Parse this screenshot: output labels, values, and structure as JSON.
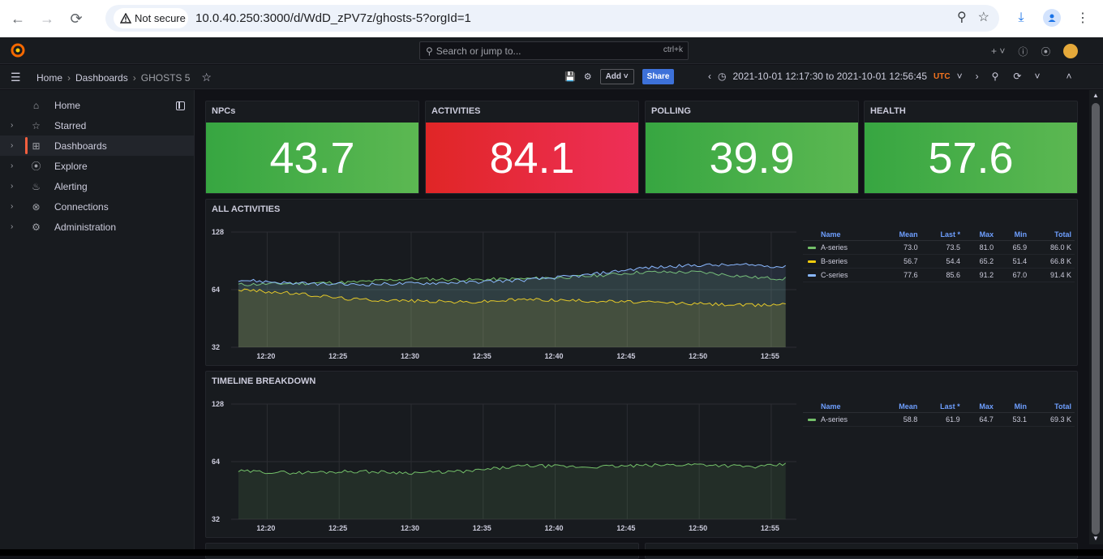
{
  "browser": {
    "security_label": "Not secure",
    "url": "10.0.40.250:3000/d/WdD_zPV7z/ghosts-5?orgId=1"
  },
  "topbar": {
    "search_placeholder": "Search or jump to...",
    "search_shortcut": "ctrl+k",
    "plus_label": "+"
  },
  "breadcrumb": {
    "home": "Home",
    "dashboards": "Dashboards",
    "current": "GHOSTS 5"
  },
  "toolbar": {
    "add_label": "Add",
    "share_label": "Share",
    "time_range": "2021-10-01 12:17:30 to 2021-10-01 12:56:45",
    "timezone": "UTC"
  },
  "sidebar": {
    "items": [
      {
        "label": "Home",
        "icon": "home-icon"
      },
      {
        "label": "Starred",
        "icon": "star-icon"
      },
      {
        "label": "Dashboards",
        "icon": "apps-icon"
      },
      {
        "label": "Explore",
        "icon": "compass-icon"
      },
      {
        "label": "Alerting",
        "icon": "bell-icon"
      },
      {
        "label": "Connections",
        "icon": "plug-icon"
      },
      {
        "label": "Administration",
        "icon": "cog-icon"
      }
    ]
  },
  "stats": [
    {
      "title": "NPCs",
      "value": "43.7",
      "color": "green"
    },
    {
      "title": "ACTIVITIES",
      "value": "84.1",
      "color": "red"
    },
    {
      "title": "POLLING",
      "value": "39.9",
      "color": "green"
    },
    {
      "title": "HEALTH",
      "value": "57.6",
      "color": "green"
    }
  ],
  "colors": {
    "a_series": "#73bf69",
    "b_series": "#f2cc0c",
    "c_series": "#8ab8ff",
    "stat_green": "#56a64b",
    "stat_red": "#e02f44"
  },
  "panels": {
    "all_activities": {
      "title": "ALL ACTIVITIES",
      "legend_headers": [
        "Name",
        "Mean",
        "Last *",
        "Max",
        "Min",
        "Total"
      ],
      "rows": [
        {
          "name": "A-series",
          "mean": "73.0",
          "last": "73.5",
          "max": "81.0",
          "min": "65.9",
          "total": "86.0 K"
        },
        {
          "name": "B-series",
          "mean": "56.7",
          "last": "54.4",
          "max": "65.2",
          "min": "51.4",
          "total": "66.8 K"
        },
        {
          "name": "C-series",
          "mean": "77.6",
          "last": "85.6",
          "max": "91.2",
          "min": "67.0",
          "total": "91.4 K"
        }
      ]
    },
    "timeline_breakdown": {
      "title": "TIMELINE BREAKDOWN",
      "legend_headers": [
        "Name",
        "Mean",
        "Last *",
        "Max",
        "Min",
        "Total"
      ],
      "rows": [
        {
          "name": "A-series",
          "mean": "58.8",
          "last": "61.9",
          "max": "64.7",
          "min": "53.1",
          "total": "69.3 K"
        }
      ]
    }
  },
  "chart_data": [
    {
      "type": "area",
      "title": "ALL ACTIVITIES",
      "x_ticks": [
        "12:20",
        "12:25",
        "12:30",
        "12:35",
        "12:40",
        "12:45",
        "12:50",
        "12:55"
      ],
      "y_ticks": [
        "32",
        "64",
        "128"
      ],
      "ylim": [
        32,
        128
      ],
      "yscale": "log2",
      "x_range": [
        "12:17:30",
        "12:56:45"
      ],
      "series": [
        {
          "name": "A-series",
          "color": "#73bf69",
          "x": [
            "12:18",
            "12:22",
            "12:26",
            "12:30",
            "12:34",
            "12:38",
            "12:42",
            "12:46",
            "12:50",
            "12:54",
            "12:56"
          ],
          "values": [
            68,
            69,
            70,
            73,
            72,
            73,
            75,
            79,
            79,
            74,
            73
          ]
        },
        {
          "name": "B-series",
          "color": "#f2cc0c",
          "x": [
            "12:18",
            "12:22",
            "12:26",
            "12:30",
            "12:34",
            "12:38",
            "12:42",
            "12:46",
            "12:50",
            "12:54",
            "12:56"
          ],
          "values": [
            64,
            61,
            57,
            56,
            55,
            57,
            56,
            55,
            54,
            53,
            54
          ]
        },
        {
          "name": "C-series",
          "color": "#8ab8ff",
          "x": [
            "12:18",
            "12:22",
            "12:26",
            "12:30",
            "12:34",
            "12:38",
            "12:42",
            "12:46",
            "12:50",
            "12:54",
            "12:56"
          ],
          "values": [
            72,
            69,
            68,
            69,
            70,
            72,
            76,
            83,
            86,
            86,
            84
          ]
        }
      ]
    },
    {
      "type": "area",
      "title": "TIMELINE BREAKDOWN",
      "x_ticks": [
        "12:20",
        "12:25",
        "12:30",
        "12:35",
        "12:40",
        "12:45",
        "12:50",
        "12:55"
      ],
      "y_ticks": [
        "32",
        "64",
        "128"
      ],
      "ylim": [
        32,
        128
      ],
      "yscale": "log2",
      "x_range": [
        "12:17:30",
        "12:56:45"
      ],
      "series": [
        {
          "name": "A-series",
          "color": "#73bf69",
          "x": [
            "12:18",
            "12:22",
            "12:26",
            "12:30",
            "12:34",
            "12:38",
            "12:42",
            "12:46",
            "12:50",
            "12:54",
            "12:56"
          ],
          "values": [
            57,
            56,
            57,
            56,
            57,
            61,
            60,
            61,
            62,
            60,
            62
          ]
        }
      ]
    }
  ]
}
